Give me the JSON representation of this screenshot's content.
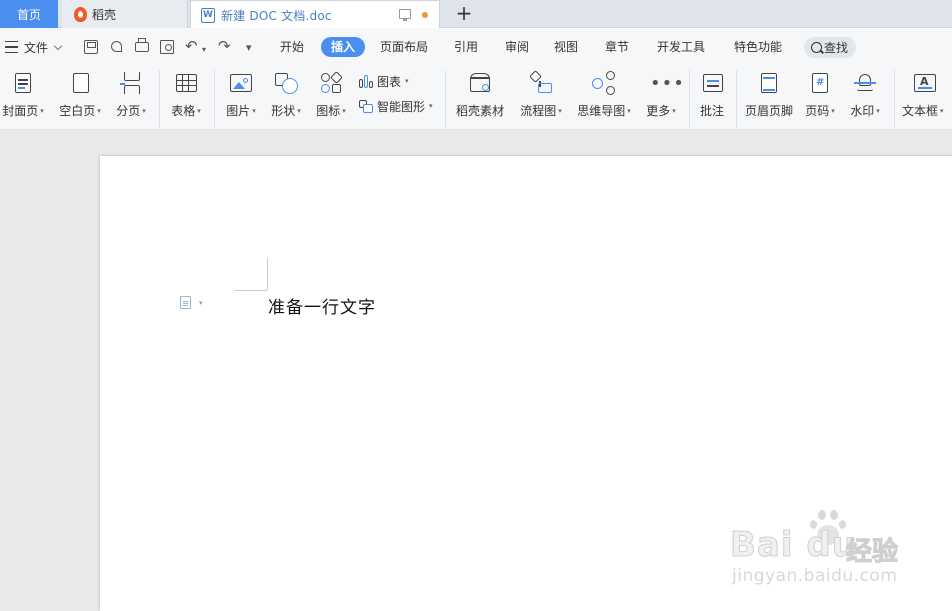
{
  "tabs": {
    "home": "首页",
    "daoke": "稻壳",
    "document": "新建 DOC 文档.doc",
    "doc_icon_letter": "W",
    "new_tab": "+"
  },
  "menu": {
    "file": "文件",
    "quick_glyphs": {
      "undo": "↶",
      "redo": "↷",
      "more": "▾",
      "undo_drop": "▾"
    },
    "tabs": [
      {
        "label": "开始",
        "active": false
      },
      {
        "label": "插入",
        "active": true
      },
      {
        "label": "页面布局",
        "active": false
      },
      {
        "label": "引用",
        "active": false
      },
      {
        "label": "审阅",
        "active": false
      },
      {
        "label": "视图",
        "active": false
      },
      {
        "label": "章节",
        "active": false
      },
      {
        "label": "开发工具",
        "active": false
      },
      {
        "label": "特色功能",
        "active": false
      }
    ],
    "search": "查找"
  },
  "ribbon": {
    "cover_page": "封面页",
    "blank_page": "空白页",
    "page_break": "分页",
    "table": "表格",
    "picture": "图片",
    "shape": "形状",
    "icon": "图标",
    "chart": "图表",
    "smart_art": "智能图形",
    "daoke_material": "稻壳素材",
    "flowchart": "流程图",
    "mind_map": "思维导图",
    "more": "更多",
    "comment": "批注",
    "header_footer": "页眉页脚",
    "page_number": "页码",
    "watermark": "水印",
    "text_box": "文本框",
    "dropdown_caret": "▾"
  },
  "document": {
    "body_text": "准备一行文字"
  },
  "watermark": {
    "logo": "Bai du",
    "cn": "经验",
    "url": "jingyan.baidu.com"
  },
  "colors": {
    "accent": "#4a8ef0",
    "daoke_brand": "#f05a28",
    "unsaved": "#f0953a"
  }
}
